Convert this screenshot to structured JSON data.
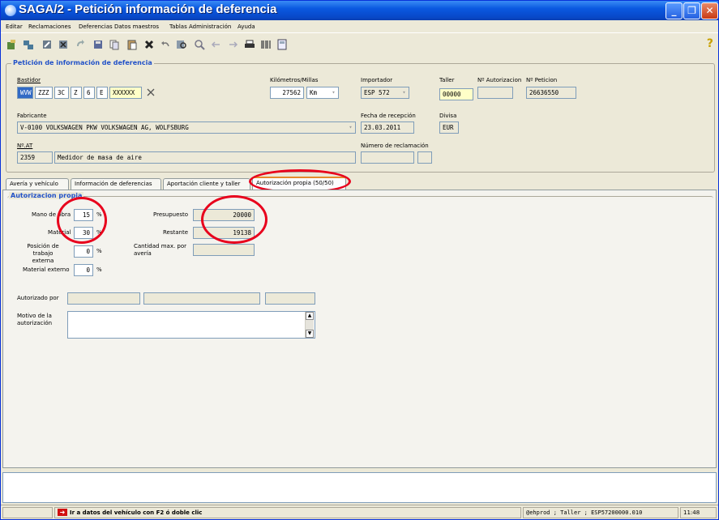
{
  "window": {
    "title": "SAGA/2 - Petición información de deferencia"
  },
  "menu": [
    "Editar",
    "Reclamaciones",
    "Deferencias",
    "Datos maestros",
    "Tablas",
    "Administración",
    "Ayuda"
  ],
  "group": {
    "title": "Petición de información de deferencia"
  },
  "form": {
    "bastidor_label": "Bastidor",
    "bastidor": [
      "WVW",
      "ZZZ",
      "3C",
      "Z",
      "6",
      "E",
      "XXXXXX"
    ],
    "km_label": "Kilómetros/Millas",
    "km_value": "27562",
    "km_unit": "Km",
    "importador_label": "Importador",
    "importador_value": "ESP 572",
    "taller_label": "Taller",
    "taller_value": "00000",
    "autorizacion_label": "Nº Autorizacion",
    "peticion_label": "Nº Peticion",
    "peticion_value": "26636550",
    "fabricante_label": "Fabricante",
    "fabricante_value": "V-0100 VOLKSWAGEN PKW VOLKSWAGEN AG, WOLFSBURG",
    "fecha_label": "Fecha de recepción",
    "fecha_value": "23.03.2011",
    "divisa_label": "Divisa",
    "divisa_value": "EUR",
    "nat_label": "Nº.AT",
    "nat_code": "2359",
    "nat_desc": "Medidor de masa de aire",
    "reclamacion_label": "Número de reclamación"
  },
  "tabs": [
    "Avería y vehículo",
    "Información de deferencias",
    "Aportación cliente y taller",
    "Autorización propia (50/50)"
  ],
  "panel": {
    "title": "Autorizacion propia",
    "mano_label": "Mano de obra",
    "mano_value": "15",
    "material_label": "Material",
    "material_value": "30",
    "posicion_label": "Posición de trabajo externa",
    "posicion_value": "0",
    "matext_label": "Material externo",
    "matext_value": "0",
    "pct": "%",
    "presupuesto_label": "Presupuesto",
    "presupuesto_value": "20000",
    "restante_label": "Restante",
    "restante_value": "19138",
    "cantidad_label": "Cantidad max. por avería",
    "autorizado_label": "Autorizado por",
    "motivo_label": "Motivo de la autorización"
  },
  "status": {
    "hint": "Ir a datos del vehículo con F2 ó doble clic",
    "session": "@ehprod ; Taller ; ESP57200000.010",
    "time": "11:48"
  },
  "icons": [
    "new-icon",
    "split-icon",
    "edit-icon",
    "delete-icon",
    "refresh-icon",
    "save-icon",
    "copy-icon",
    "paste-icon",
    "cancel-icon",
    "undo-icon",
    "find-icon",
    "zoom-icon",
    "back-icon",
    "forward-icon",
    "print-icon",
    "barcode-icon",
    "calculator-icon",
    "help-icon"
  ],
  "colors": {
    "accent": "#2151c8",
    "highlight": "#e8001c",
    "title_bar": "#0a58e0"
  }
}
